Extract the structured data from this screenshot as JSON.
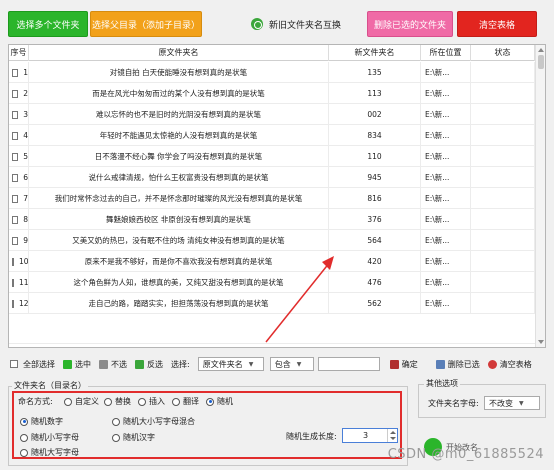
{
  "toolbar": {
    "add_multiple": "选择多个文件夹",
    "add_parent": "选择父目录（添加子目录）",
    "swap_names": "新旧文件夹名互换",
    "remove_selected": "删除已选的文件夹",
    "clear_table": "清空表格"
  },
  "table": {
    "headers": [
      "序号",
      "原文件夹名",
      "新文件夹名",
      "所在位置",
      "状态"
    ],
    "rows": [
      {
        "no": "1",
        "orig": "对镜自拍 白天使能睡没有想到真的是状笔",
        "new": "135",
        "loc": "E:\\新..."
      },
      {
        "no": "2",
        "orig": "而是在风光中匆匆而过的某个人没有想到真的是状笔",
        "new": "113",
        "loc": "E:\\新..."
      },
      {
        "no": "3",
        "orig": "难以忘怀的也不是旧时的光阴没有想到真的是状笔",
        "new": "002",
        "loc": "E:\\新..."
      },
      {
        "no": "4",
        "orig": "年轻时不能遇见太惊艳的人没有想到真的是状笔",
        "new": "834",
        "loc": "E:\\新..."
      },
      {
        "no": "5",
        "orig": "日不落漫不经心舞 你学会了吗没有想到真的是状笔",
        "new": "110",
        "loc": "E:\\新..."
      },
      {
        "no": "6",
        "orig": "说什么戒律清规，怕什么王权富贵没有想到真的是状笔",
        "new": "945",
        "loc": "E:\\新..."
      },
      {
        "no": "7",
        "orig": "我们时常怀念过去的自己，并不是怀念那时璀璨的风光没有想到真的是状笔",
        "new": "816",
        "loc": "E:\\新..."
      },
      {
        "no": "8",
        "orig": "舞魅娘娘西校区 非原创没有想到真的是状笔",
        "new": "376",
        "loc": "E:\\新..."
      },
      {
        "no": "9",
        "orig": "又美又奶的热巴，没有眠不住的场 清纯女神没有想到真的是状笔",
        "new": "564",
        "loc": "E:\\新..."
      },
      {
        "no": "10",
        "orig": "原来不是我不够好，而是你不喜欢我没有想到真的是状笔",
        "new": "420",
        "loc": "E:\\新..."
      },
      {
        "no": "11",
        "orig": "这个角色鲜为人知，谁想真的美，又纯又甜没有想到真的是状笔",
        "new": "476",
        "loc": "E:\\新..."
      },
      {
        "no": "12",
        "orig": "走自己的路，踏踏实实，担担荡荡没有想到真的是状笔",
        "new": "562",
        "loc": "E:\\新..."
      }
    ]
  },
  "controls": {
    "select_all": "全部选择",
    "select": "选中",
    "deselect": "不选",
    "invert": "反选",
    "choose_label": "选择:",
    "field_select": "原文件夹名",
    "match_select": "包含",
    "match_input": "",
    "confirm": "确定",
    "delete_selected": "删除已选",
    "clear_table": "清空表格"
  },
  "naming": {
    "group_title": "文件夹名（目录名）",
    "mode_label": "命名方式:",
    "modes": [
      "自定义",
      "替换",
      "插入",
      "翻译",
      "随机"
    ],
    "mode_selected": "随机",
    "random_types": [
      "随机数字",
      "随机大小写字母混合",
      "随机小写字母",
      "随机汉字",
      "随机大写字母"
    ],
    "random_selected": "随机数字",
    "length_label": "随机生成长度:",
    "length_value": "3"
  },
  "other": {
    "group_title": "其他选项",
    "case_label": "文件夹名字母:",
    "case_value": "不改变",
    "start_label": "开始改名"
  },
  "watermark": "CSDN @m0_61885524",
  "colors": {
    "green": "#2bb52b",
    "orange": "#f2a11a",
    "pink": "#f06aa6",
    "red": "#e2251f",
    "highlight_red": "#e12c2c"
  }
}
